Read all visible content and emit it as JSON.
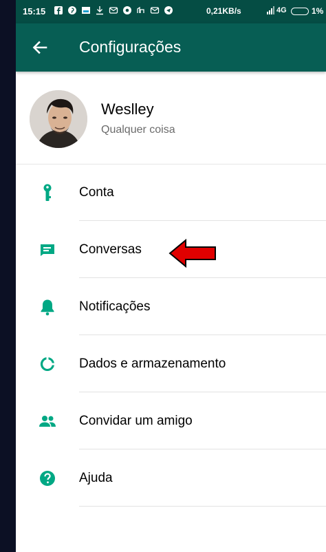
{
  "status_bar": {
    "time": "15:15",
    "network_speed": "0,21KB/s",
    "network_type": "4G",
    "battery": "1%"
  },
  "app_bar": {
    "title": "Configurações",
    "back_icon": "arrow-left-icon"
  },
  "profile": {
    "name": "Weslley",
    "status": "Qualquer coisa"
  },
  "menu": [
    {
      "label": "Conta",
      "icon": "key-icon"
    },
    {
      "label": "Conversas",
      "icon": "chat-icon"
    },
    {
      "label": "Notificações",
      "icon": "bell-icon"
    },
    {
      "label": "Dados e armazenamento",
      "icon": "data-usage-icon"
    },
    {
      "label": "Convidar um amigo",
      "icon": "people-icon"
    },
    {
      "label": "Ajuda",
      "icon": "help-icon"
    }
  ],
  "colors": {
    "app_bar": "#075e54",
    "status_bar": "#054d44",
    "accent": "#00a884",
    "annotation_arrow": "#e00000"
  }
}
